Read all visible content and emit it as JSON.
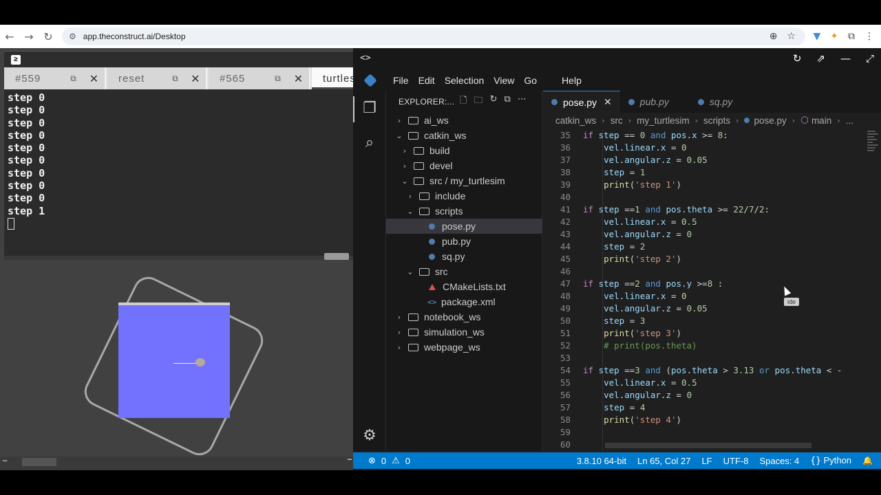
{
  "browser": {
    "url": "app.theconstruct.ai/Desktop"
  },
  "terminal": {
    "tabs": [
      {
        "label": "#559",
        "active": false
      },
      {
        "label": "reset",
        "active": false
      },
      {
        "label": "#565",
        "active": false
      },
      {
        "label": "turtles",
        "active": true
      }
    ],
    "lines": [
      "step 0",
      "step 0",
      "step 0",
      "step 0",
      "step 0",
      "step 0",
      "step 0",
      "step 0",
      "step 0",
      "step 1"
    ]
  },
  "vscode": {
    "menu": [
      "File",
      "Edit",
      "Selection",
      "View",
      "Go",
      "Help"
    ],
    "explorer_title": "EXPLORER:...",
    "tree": [
      {
        "label": "ai_ws",
        "depth": 0,
        "type": "folder",
        "open": false
      },
      {
        "label": "catkin_ws",
        "depth": 0,
        "type": "folder",
        "open": true
      },
      {
        "label": "build",
        "depth": 1,
        "type": "folder",
        "open": false
      },
      {
        "label": "devel",
        "depth": 1,
        "type": "folder",
        "open": false
      },
      {
        "label": "src / my_turtlesim",
        "depth": 1,
        "type": "folder",
        "open": true
      },
      {
        "label": "include",
        "depth": 2,
        "type": "folder",
        "open": false
      },
      {
        "label": "scripts",
        "depth": 2,
        "type": "folder",
        "open": true
      },
      {
        "label": "pose.py",
        "depth": 3,
        "type": "py",
        "selected": true
      },
      {
        "label": "pub.py",
        "depth": 3,
        "type": "py"
      },
      {
        "label": "sq.py",
        "depth": 3,
        "type": "py"
      },
      {
        "label": "src",
        "depth": 2,
        "type": "folder",
        "open": true
      },
      {
        "label": "CMakeLists.txt",
        "depth": 3,
        "type": "cmake"
      },
      {
        "label": "package.xml",
        "depth": 3,
        "type": "xml"
      },
      {
        "label": "notebook_ws",
        "depth": 0,
        "type": "folder",
        "open": false
      },
      {
        "label": "simulation_ws",
        "depth": 0,
        "type": "folder",
        "open": false
      },
      {
        "label": "webpage_ws",
        "depth": 0,
        "type": "folder",
        "open": false
      }
    ],
    "editor_tabs": [
      {
        "label": "pose.py",
        "active": true
      },
      {
        "label": "pub.py",
        "active": false
      },
      {
        "label": "sq.py",
        "active": false
      }
    ],
    "breadcrumbs": [
      "catkin_ws",
      "src",
      "my_turtlesim",
      "scripts",
      "pose.py",
      "main",
      "..."
    ],
    "code_lines": [
      {
        "n": "35",
        "t": "if step == 0 and pos.x >= 8:"
      },
      {
        "n": "36",
        "t": "    vel.linear.x = 0"
      },
      {
        "n": "37",
        "t": "    vel.angular.z = 0.05"
      },
      {
        "n": "38",
        "t": "    step = 1"
      },
      {
        "n": "39",
        "t": "    print('step 1')"
      },
      {
        "n": "40",
        "t": ""
      },
      {
        "n": "41",
        "t": "if step ==1 and pos.theta >= 22/7/2:"
      },
      {
        "n": "42",
        "t": "    vel.linear.x = 0.5"
      },
      {
        "n": "43",
        "t": "    vel.angular.z = 0"
      },
      {
        "n": "44",
        "t": "    step = 2"
      },
      {
        "n": "45",
        "t": "    print('step 2')"
      },
      {
        "n": "46",
        "t": ""
      },
      {
        "n": "47",
        "t": "if step ==2 and pos.y >=8 :"
      },
      {
        "n": "48",
        "t": "    vel.linear.x = 0"
      },
      {
        "n": "49",
        "t": "    vel.angular.z = 0.05"
      },
      {
        "n": "50",
        "t": "    step = 3"
      },
      {
        "n": "51",
        "t": "    print('step 3')"
      },
      {
        "n": "52",
        "t": "    # print(pos.theta)"
      },
      {
        "n": "53",
        "t": ""
      },
      {
        "n": "54",
        "t": "if step ==3 and (pos.theta > 3.13 or pos.theta < -"
      },
      {
        "n": "55",
        "t": "    vel.linear.x = 0.5"
      },
      {
        "n": "56",
        "t": "    vel.angular.z = 0"
      },
      {
        "n": "57",
        "t": "    step = 4"
      },
      {
        "n": "58",
        "t": "    print('step 4')"
      },
      {
        "n": "59",
        "t": ""
      },
      {
        "n": "60",
        "t": ""
      }
    ],
    "tooltip": "ide",
    "status": {
      "errors": "0",
      "warnings": "0",
      "python_version": "3.8.10 64-bit",
      "position": "Ln 65, Col 27",
      "eol": "LF",
      "encoding": "UTF-8",
      "spaces": "Spaces: 4",
      "language": "Python"
    }
  }
}
